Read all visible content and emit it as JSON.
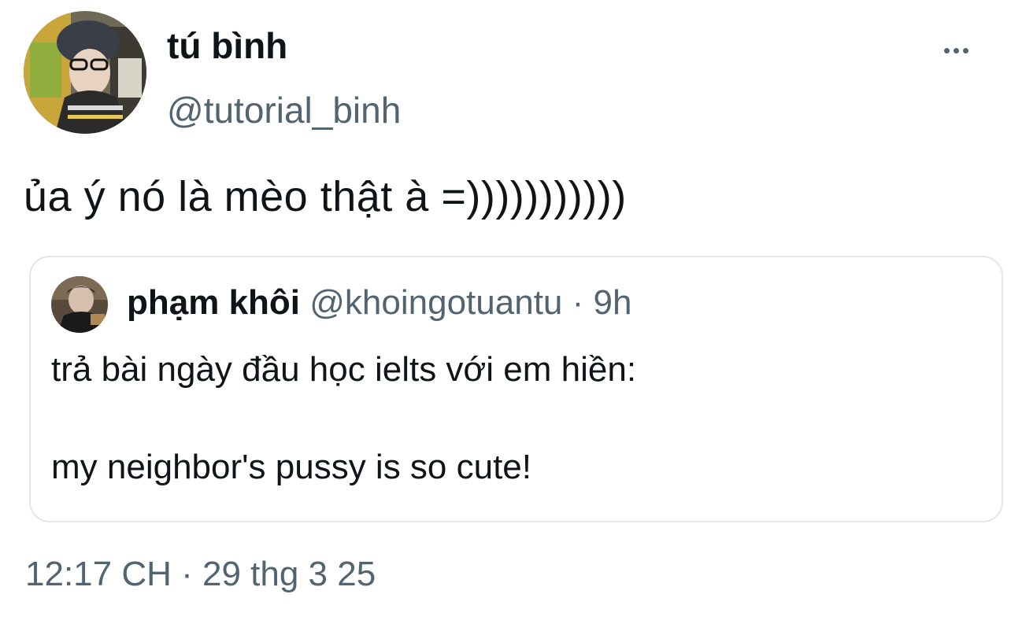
{
  "tweet": {
    "author": {
      "display_name": "tú bình",
      "handle": "@tutorial_binh"
    },
    "more_icon": "more-horizontal-icon",
    "text": "ủa ý nó là mèo thật à =)))))))))))",
    "timestamp": "12:17 CH · 29 thg 3 25"
  },
  "quoted_tweet": {
    "author": {
      "display_name": "phạm khôi",
      "handle": "@khoingotuantu",
      "time": "· 9h"
    },
    "text_line1": "trả bài ngày đầu học ielts với em hiền:",
    "text_line2": "my neighbor's pussy is so cute!"
  },
  "colors": {
    "text_primary": "#0f1419",
    "text_secondary": "#536471",
    "card_border": "#e3e7ea"
  }
}
